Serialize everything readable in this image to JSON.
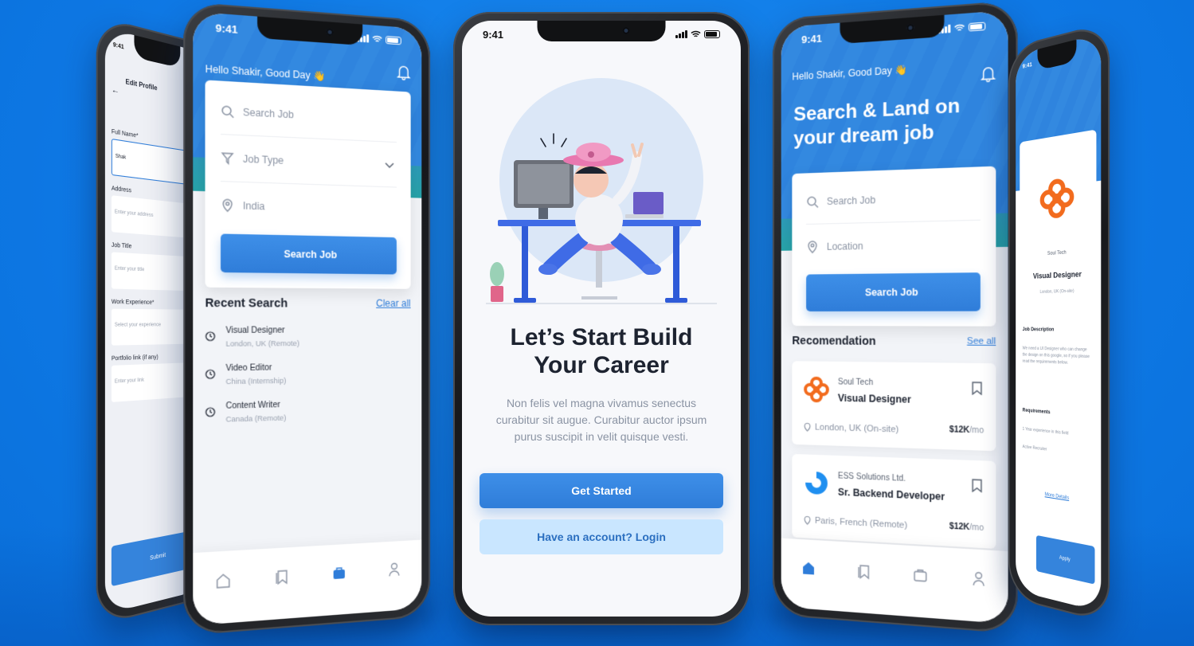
{
  "colors": {
    "background": "#0e79e6",
    "primary": "#2f7dd9",
    "accent_teal": "#27a3a8",
    "brand_orange": "#f26b1d"
  },
  "phone_center": {
    "time": "9:41",
    "headline_line1": "Let’s Start Build",
    "headline_line2": "Your Career",
    "subtext": "Non felis vel magna vivamus senectus curabitur sit augue. Curabitur auctor ipsum purus suscipit in velit quisque vesti.",
    "primary_button": "Get Started",
    "secondary_button": "Have an account? Login"
  },
  "phone_left": {
    "time": "9:41",
    "greeting": "Hello Shakir, Good Day 👋",
    "search_placeholder": "Search Job",
    "job_type_placeholder": "Job Type",
    "location_value": "India",
    "search_button": "Search Job",
    "recent_title": "Recent Search",
    "clear_all": "Clear all",
    "recent": [
      {
        "title": "Visual Designer",
        "sub": "London, UK (Remote)"
      },
      {
        "title": "Video Editor",
        "sub": "China (Internship)"
      },
      {
        "title": "Content Writer",
        "sub": "Canada (Remote)"
      }
    ]
  },
  "phone_far_left": {
    "time": "9:41",
    "title": "Edit Profile",
    "fields": [
      {
        "label": "Full Name*",
        "value": "Shak"
      },
      {
        "label": "Address",
        "value": "Enter your address"
      },
      {
        "label": "Job Title",
        "value": "Enter your title"
      },
      {
        "label": "Work Experience*",
        "value": "Select your experience"
      },
      {
        "label": "Portfolio link (if any)",
        "value": "Enter your link"
      }
    ],
    "button": "Submit"
  },
  "phone_right": {
    "time": "9:41",
    "greeting": "Hello Shakir, Good Day 👋",
    "headline": "Search & Land on your dream job",
    "search_placeholder": "Search Job",
    "location_placeholder": "Location",
    "search_button": "Search Job",
    "reco_title": "Recomendation",
    "see_all": "See all",
    "jobs": [
      {
        "company": "Soul Tech",
        "title": "Visual Designer",
        "location": "London, UK (On-site)",
        "salary": "$12K",
        "period": "/mo"
      },
      {
        "company": "ESS Solutions Ltd.",
        "title": "Sr. Backend Developer",
        "location": "Paris, French (Remote)",
        "salary": "$12K",
        "period": "/mo"
      }
    ]
  },
  "phone_far_right": {
    "time": "9:41",
    "company": "Soul Tech",
    "title": "Visual Designer",
    "location": "London, UK (On-site)",
    "desc_title": "Job Description",
    "desc": "We need a UI Designer who can change the design on this google, so if you please read the requirements below.",
    "req_title": "Requirements",
    "req_1": "1 Year experience in this field",
    "req_2": "Active Recruiter",
    "more": "More Details",
    "apply": "Apply"
  }
}
